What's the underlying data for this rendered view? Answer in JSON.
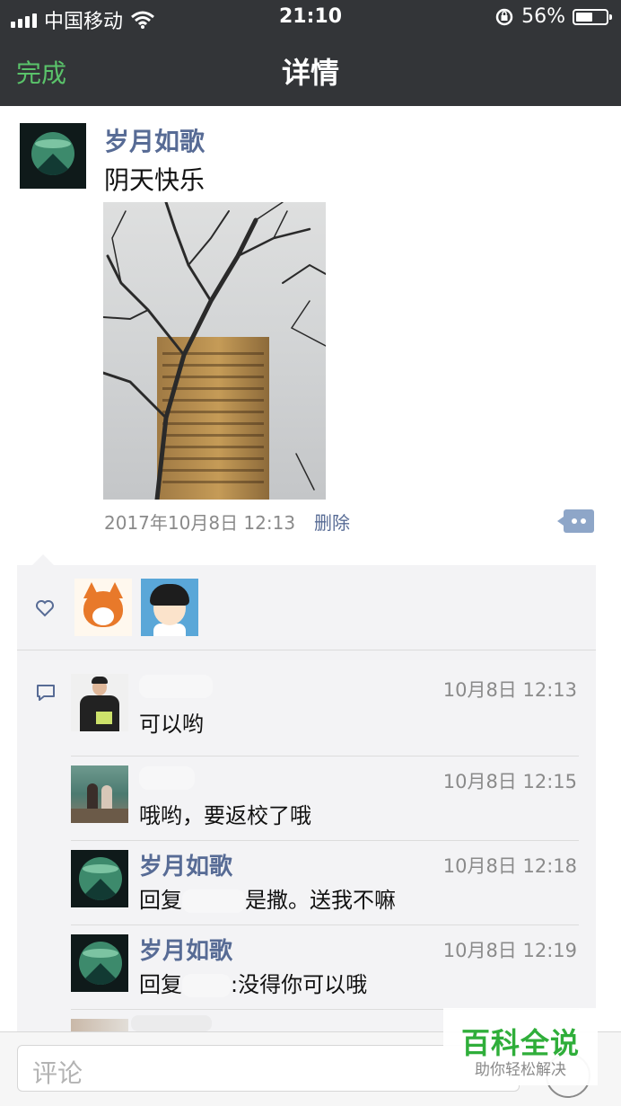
{
  "status_bar": {
    "carrier": "中国移动",
    "time": "21:10",
    "battery": "56%",
    "battery_level": 0.56
  },
  "nav": {
    "done_label": "完成",
    "title": "详情"
  },
  "post": {
    "username": "岁月如歌",
    "text": "阴天快乐",
    "timestamp": "2017年10月8日 12:13",
    "delete_label": "删除"
  },
  "comments": [
    {
      "name": "",
      "time": "10月8日 12:13",
      "text": "可以哟"
    },
    {
      "name": "",
      "time": "10月8日 12:15",
      "text": "哦哟，要返校了哦"
    },
    {
      "name": "岁月如歌",
      "time": "10月8日 12:18",
      "reply_prefix": "回复",
      "text": "是撒。送我不嘛"
    },
    {
      "name": "岁月如歌",
      "time": "10月8日 12:19",
      "reply_prefix": "回复",
      "text": ":没得你可以哦"
    }
  ],
  "comment_input": {
    "placeholder": "评论"
  },
  "watermark": {
    "title": "百科全说",
    "subtitle": "助你轻松解决"
  },
  "colors": {
    "nav_bg": "#333538",
    "accent_green": "#5ac36a",
    "link_blue": "#576b95",
    "panel_bg": "#f3f3f5"
  }
}
